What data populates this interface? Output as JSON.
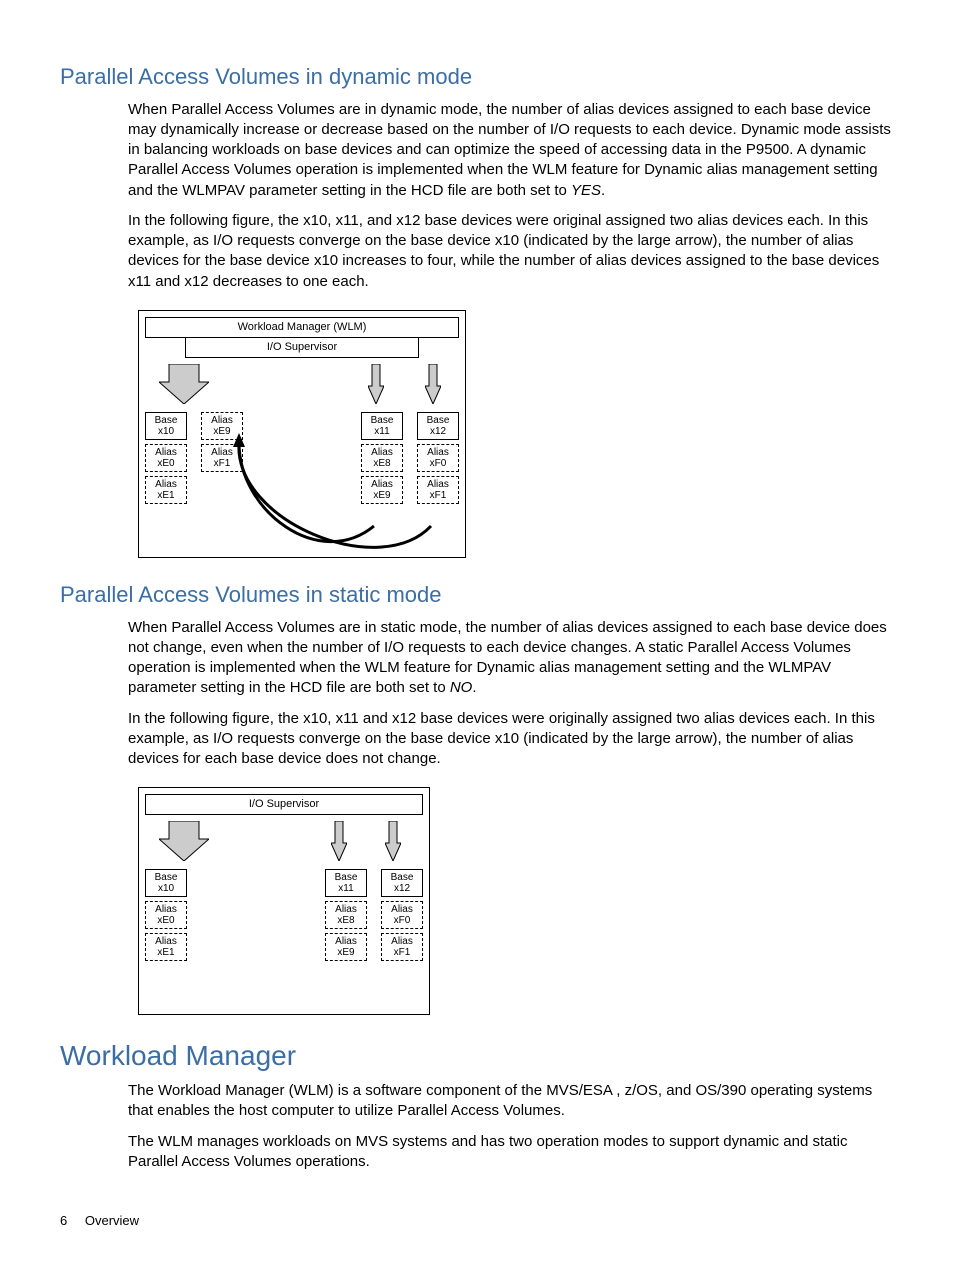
{
  "sections": {
    "dynamic": {
      "title": "Parallel Access Volumes in dynamic mode",
      "p1": "When Parallel Access Volumes are in dynamic mode, the number of alias devices assigned to each base device may dynamically increase or decrease based on the number of I/O requests to each device. Dynamic mode assists in balancing workloads on base devices and can optimize the speed of accessing data in the P9500. A dynamic Parallel Access Volumes operation is implemented when the WLM feature for Dynamic alias management setting and the WLMPAV parameter setting in the HCD file are both set to ",
      "p1_em": "YES",
      "p1_tail": ".",
      "p2": "In the following figure, the x10, x11, and x12 base devices were original assigned two alias devices each. In this example, as I/O requests converge on the base device x10 (indicated by the large arrow), the number of alias devices for the base device x10 increases to four, while the number of alias devices assigned to the base devices x11 and x12 decreases to one each."
    },
    "static": {
      "title": "Parallel Access Volumes in static mode",
      "p1": "When Parallel Access Volumes are in static mode, the number of alias devices assigned to each base device does not change, even when the number of I/O requests to each device changes. A static Parallel Access Volumes operation is implemented when the WLM feature for Dynamic alias management setting and the WLMPAV parameter setting in the HCD file are both set to ",
      "p1_em": "NO",
      "p1_tail": ".",
      "p2": "In the following figure, the x10, x11 and x12 base devices were originally assigned two alias devices each. In this example, as I/O requests converge on the base device x10 (indicated by the large arrow), the number of alias devices for each base device does not change."
    },
    "wlm": {
      "title": "Workload Manager",
      "p1": "The Workload Manager (WLM) is a software component of the MVS/ESA , z/OS, and OS/390 operating systems that enables the host computer to utilize Parallel Access Volumes.",
      "p2": "The WLM manages workloads on MVS systems and has two operation modes to support dynamic and static Parallel Access Volumes operations."
    }
  },
  "diagram1": {
    "header": "Workload Manager (WLM)",
    "sub": "I/O Supervisor",
    "row1": [
      "Base\nx10",
      "Alias\nxE9",
      "Base\nx11",
      "Base\nx12"
    ],
    "row2": [
      "Alias\nxE0",
      "Alias\nxF1",
      "Alias\nxE8",
      "Alias\nxF0"
    ],
    "row3": [
      "Alias\nxE1",
      "",
      "Alias\nxE9",
      "Alias\nxF1"
    ]
  },
  "diagram2": {
    "sub": "I/O Supervisor",
    "row1": [
      "Base\nx10",
      "Base\nx11",
      "Base\nx12"
    ],
    "row2": [
      "Alias\nxE0",
      "Alias\nxE8",
      "Alias\nxF0"
    ],
    "row3": [
      "Alias\nxE1",
      "Alias\nxE9",
      "Alias\nxF1"
    ]
  },
  "footer": {
    "page": "6",
    "section": "Overview"
  }
}
